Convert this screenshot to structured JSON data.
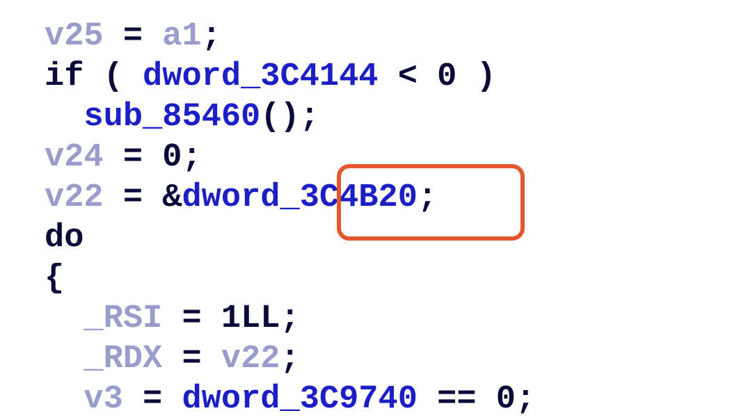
{
  "code_lines": [
    {
      "indent": "",
      "tokens": [
        {
          "t": "v25",
          "k": "var"
        },
        {
          "t": " = ",
          "k": "op"
        },
        {
          "t": "a1",
          "k": "var"
        },
        {
          "t": ";",
          "k": "op"
        }
      ]
    },
    {
      "indent": "",
      "tokens": [
        {
          "t": "if",
          "k": "kw"
        },
        {
          "t": " ( ",
          "k": "op"
        },
        {
          "t": "dword_3C4144",
          "k": "ident"
        },
        {
          "t": " < ",
          "k": "op"
        },
        {
          "t": "0",
          "k": "num"
        },
        {
          "t": " )",
          "k": "op"
        }
      ]
    },
    {
      "indent": "  ",
      "tokens": [
        {
          "t": "sub_85460",
          "k": "ident"
        },
        {
          "t": "();",
          "k": "op"
        }
      ]
    },
    {
      "indent": "",
      "tokens": [
        {
          "t": "v24",
          "k": "var"
        },
        {
          "t": " = ",
          "k": "op"
        },
        {
          "t": "0",
          "k": "num"
        },
        {
          "t": ";",
          "k": "op"
        }
      ]
    },
    {
      "indent": "",
      "tokens": [
        {
          "t": "v22",
          "k": "var"
        },
        {
          "t": " = ",
          "k": "op"
        },
        {
          "t": "&",
          "k": "op"
        },
        {
          "t": "dword_3C4B20",
          "k": "ident"
        },
        {
          "t": ";",
          "k": "op"
        }
      ]
    },
    {
      "indent": "",
      "tokens": [
        {
          "t": "do",
          "k": "kw"
        }
      ]
    },
    {
      "indent": "",
      "tokens": [
        {
          "t": "{",
          "k": "op"
        }
      ]
    },
    {
      "indent": "  ",
      "tokens": [
        {
          "t": "_RSI",
          "k": "var"
        },
        {
          "t": " = ",
          "k": "op"
        },
        {
          "t": "1LL",
          "k": "num"
        },
        {
          "t": ";",
          "k": "op"
        }
      ]
    },
    {
      "indent": "  ",
      "tokens": [
        {
          "t": "_RDX",
          "k": "var"
        },
        {
          "t": " = ",
          "k": "op"
        },
        {
          "t": "v22",
          "k": "var"
        },
        {
          "t": ";",
          "k": "op"
        }
      ]
    },
    {
      "indent": "  ",
      "tokens": [
        {
          "t": "v3",
          "k": "var"
        },
        {
          "t": " = ",
          "k": "op"
        },
        {
          "t": "dword_3C9740",
          "k": "ident"
        },
        {
          "t": " == ",
          "k": "op"
        },
        {
          "t": "0",
          "k": "num"
        },
        {
          "t": ";",
          "k": "op"
        }
      ]
    }
  ],
  "highlight": {
    "target": "3C4B20;",
    "color": "#e4572e"
  },
  "colors": {
    "keyword": "#0b0b3a",
    "variable": "#9a9ccc",
    "identifier": "#1c1ec6",
    "background": "#ffffff"
  }
}
